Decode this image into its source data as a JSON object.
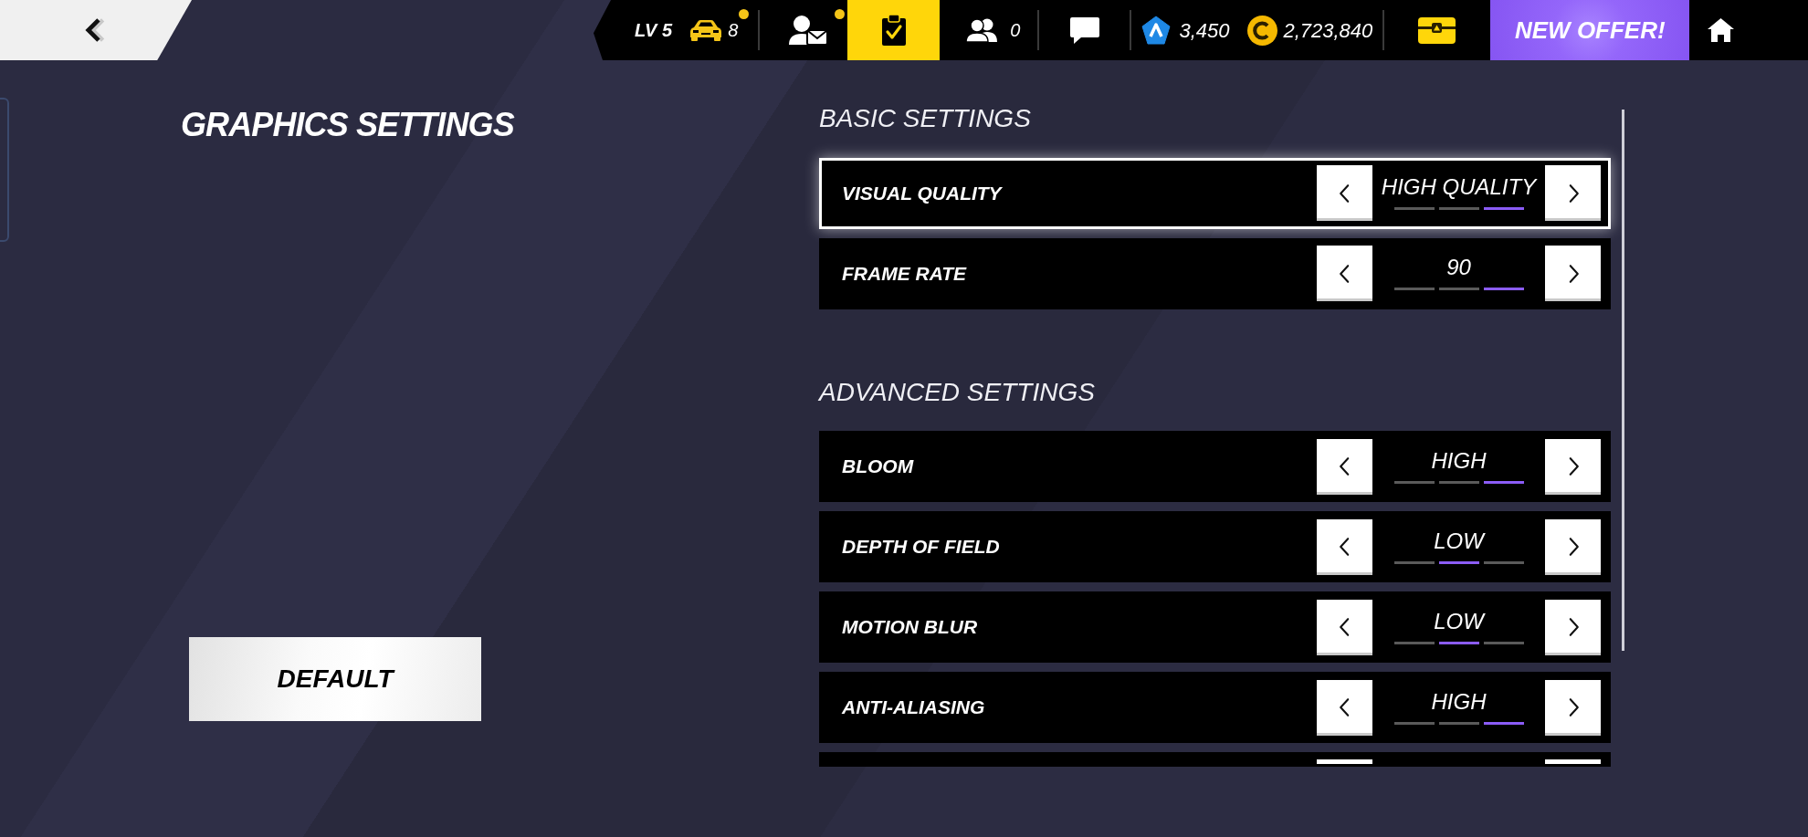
{
  "top_bar": {
    "player_level": "LV 5",
    "cars": {
      "count": "8",
      "notification": true
    },
    "mail": {
      "notification": true
    },
    "tasks": {
      "highlighted": true
    },
    "friends": {
      "count": "0"
    },
    "tokens": "3,450",
    "coins": "2,723,840",
    "offer": "NEW OFFER!"
  },
  "title": "GRAPHICS SETTINGS",
  "default_button": "DEFAULT",
  "sections": [
    {
      "heading": "BASIC SETTINGS",
      "rows": [
        {
          "label": "VISUAL QUALITY",
          "value": "HIGH QUALITY",
          "selected": true,
          "steps": [
            {
              "selected": false
            },
            {
              "selected": false
            },
            {
              "selected": true
            }
          ]
        },
        {
          "label": "FRAME RATE",
          "value": "90",
          "selected": false,
          "steps": [
            {
              "selected": false
            },
            {
              "selected": false
            },
            {
              "selected": true
            }
          ]
        }
      ]
    },
    {
      "heading": "ADVANCED SETTINGS",
      "rows": [
        {
          "label": "BLOOM",
          "value": "HIGH",
          "selected": false,
          "steps": [
            {
              "selected": false
            },
            {
              "selected": false
            },
            {
              "selected": true
            }
          ]
        },
        {
          "label": "DEPTH OF FIELD",
          "value": "LOW",
          "selected": false,
          "steps": [
            {
              "selected": false
            },
            {
              "selected": true
            },
            {
              "selected": false
            }
          ]
        },
        {
          "label": "MOTION BLUR",
          "value": "LOW",
          "selected": false,
          "steps": [
            {
              "selected": false
            },
            {
              "selected": true
            },
            {
              "selected": false
            }
          ]
        },
        {
          "label": "ANTI-ALIASING",
          "value": "HIGH",
          "selected": false,
          "steps": [
            {
              "selected": false
            },
            {
              "selected": false
            },
            {
              "selected": true
            }
          ]
        },
        {
          "selected": false
        }
      ]
    }
  ]
}
